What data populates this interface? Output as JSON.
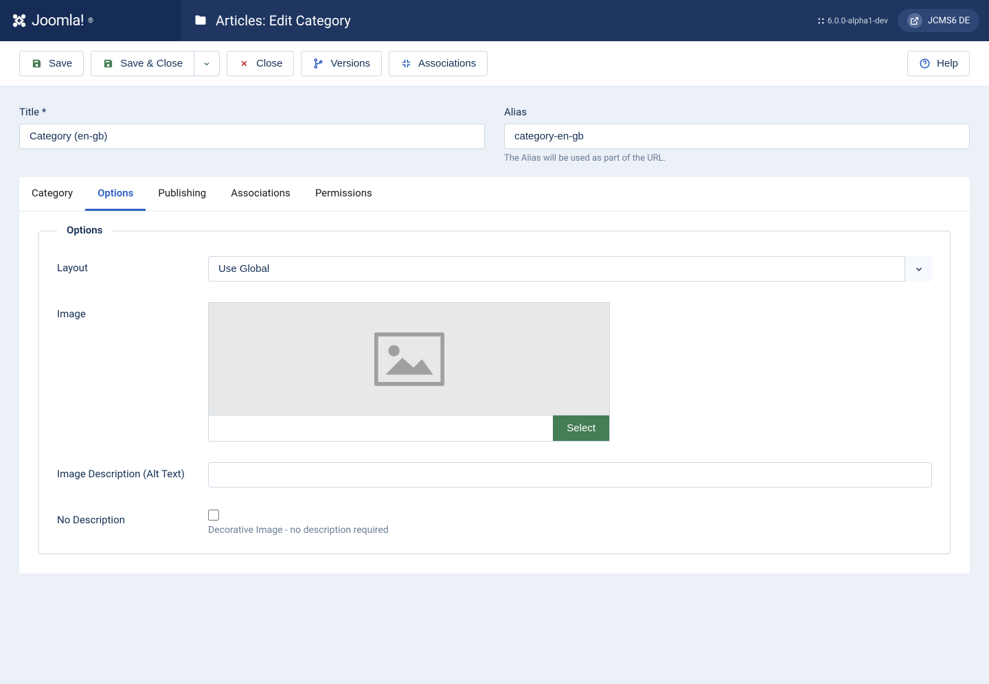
{
  "brand": "Joomla!",
  "header": {
    "title": "Articles: Edit Category",
    "version": "6.0.0-alpha1-dev",
    "site_name": "JCMS6 DE"
  },
  "toolbar": {
    "save": "Save",
    "save_close": "Save & Close",
    "close": "Close",
    "versions": "Versions",
    "associations": "Associations",
    "help": "Help"
  },
  "fields": {
    "title_label": "Title *",
    "title_value": "Category (en-gb)",
    "alias_label": "Alias",
    "alias_value": "category-en-gb",
    "alias_hint": "The Alias will be used as part of the URL."
  },
  "tabs": [
    "Category",
    "Options",
    "Publishing",
    "Associations",
    "Permissions"
  ],
  "active_tab": "Options",
  "fieldset_legend": "Options",
  "form": {
    "layout_label": "Layout",
    "layout_value": "Use Global",
    "image_label": "Image",
    "image_value": "",
    "image_select": "Select",
    "alt_label": "Image Description (Alt Text)",
    "alt_value": "",
    "nodesc_label": "No Description",
    "nodesc_hint": "Decorative Image - no description required"
  }
}
